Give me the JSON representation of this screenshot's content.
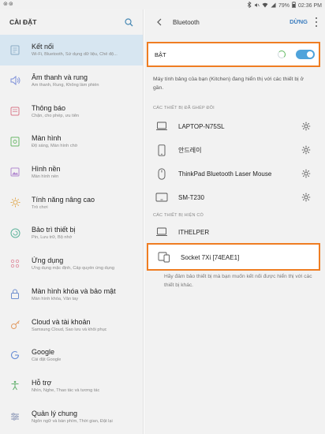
{
  "status_bar": {
    "left_icons": "⊚⊚",
    "battery": "79%",
    "time": "02:36 PM"
  },
  "left_panel": {
    "title": "CÀI ĐẶT",
    "items": [
      {
        "label": "Kết nối",
        "sub": "Wi-Fi, Bluetooth, Sử dụng dữ liệu, Chế độ...",
        "icon": "connections-icon",
        "active": true
      },
      {
        "label": "Âm thanh và rung",
        "sub": "Âm thanh, Rung, Không làm phiền",
        "icon": "sound-icon"
      },
      {
        "label": "Thông báo",
        "sub": "Chặn, cho phép, ưu tiên",
        "icon": "notifications-icon"
      },
      {
        "label": "Màn hình",
        "sub": "Độ sáng, Màn hình chờ",
        "icon": "display-icon"
      },
      {
        "label": "Hình nền",
        "sub": "Màn hình nền",
        "icon": "wallpaper-icon"
      },
      {
        "label": "Tính năng nâng cao",
        "sub": "Trò chơi",
        "icon": "advanced-features-icon"
      },
      {
        "label": "Bảo trì thiết bị",
        "sub": "Pin, Lưu trữ, Bộ nhớ",
        "icon": "device-maintenance-icon"
      },
      {
        "label": "Ứng dụng",
        "sub": "Ứng dụng mặc định, Cấp quyền ứng dụng",
        "icon": "apps-icon"
      },
      {
        "label": "Màn hình khóa và bảo mật",
        "sub": "Màn hình khóa, Vân tay",
        "icon": "lock-screen-icon"
      },
      {
        "label": "Cloud và tài khoản",
        "sub": "Samsung Cloud, Sao lưu và khôi phục",
        "icon": "cloud-icon"
      },
      {
        "label": "Google",
        "sub": "Cài đặt Google",
        "icon": "google-icon"
      },
      {
        "label": "Hỗ trợ",
        "sub": "Nhìn, Nghe, Thao tác và tương tác",
        "icon": "accessibility-icon"
      },
      {
        "label": "Quản lý chung",
        "sub": "Ngôn ngữ và bàn phím, Thời gian, Đặt lại",
        "icon": "general-management-icon"
      }
    ]
  },
  "right_panel": {
    "title": "Bluetooth",
    "stop_label": "DỪNG",
    "toggle_label": "BẬT",
    "description": "Máy tính bảng của bạn (Kitchen) đang hiển thị với các thiết bị ở gần.",
    "paired_header": "CÁC THIẾT BỊ ĐÃ GHÉP ĐÔI",
    "paired_devices": [
      {
        "name": "LAPTOP-N75SL",
        "icon": "laptop-icon"
      },
      {
        "name": "안드레이",
        "icon": "phone-icon"
      },
      {
        "name": "ThinkPad Bluetooth Laser Mouse",
        "icon": "mouse-icon"
      },
      {
        "name": "SM-T230",
        "icon": "tablet-icon"
      }
    ],
    "available_header": "CÁC THIẾT BỊ HIỆN CÓ",
    "available_devices": [
      {
        "name": "ITHELPER",
        "icon": "laptop-icon"
      },
      {
        "name": "Socket 7Xi [74EAE1]",
        "icon": "devices-icon"
      }
    ],
    "footnote": "Hãy đảm bảo thiết bị mà bạn muốn kết nối được hiển thị với các thiết bị khác."
  },
  "colors": {
    "accent": "#4fa3db",
    "highlight": "#ef7d22",
    "active_item_bg": "#d7e6f1"
  }
}
